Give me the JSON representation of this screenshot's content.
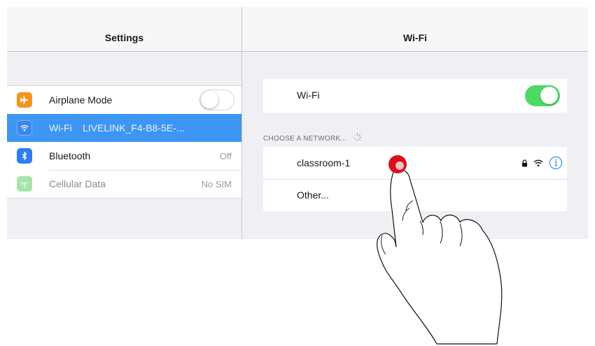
{
  "left_panel": {
    "title": "Settings",
    "items": [
      {
        "label": "Airplane Mode",
        "value": "",
        "icon": "airplane-icon"
      },
      {
        "label": "Wi-Fi",
        "value": "LIVELINK_F4-B8-5E-...",
        "icon": "wifi-icon"
      },
      {
        "label": "Bluetooth",
        "value": "Off",
        "icon": "bluetooth-icon"
      },
      {
        "label": "Cellular Data",
        "value": "No SIM",
        "icon": "cellular-icon"
      }
    ]
  },
  "right_panel": {
    "title": "Wi-Fi",
    "wifi_toggle_label": "Wi-Fi",
    "section_header": "CHOOSE A NETWORK...",
    "networks": [
      {
        "name": "classroom-1",
        "secured": true
      },
      {
        "name": "Other..."
      }
    ]
  },
  "toggles": {
    "airplane_mode": false,
    "wifi": true
  },
  "colors": {
    "accent_blue": "#3d96f4",
    "toggle_on": "#4cd964",
    "airplane_orange": "#f6931f",
    "tap_red": "#d8101c",
    "background": "#efeff4"
  }
}
